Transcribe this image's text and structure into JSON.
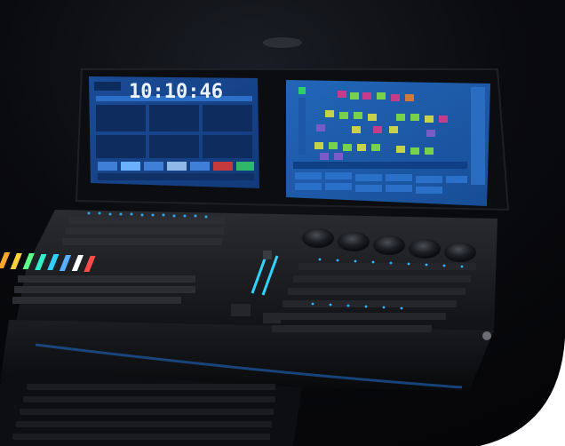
{
  "photo": {
    "subject": "lighting-control-console",
    "left_screen": {
      "clock": "10:10:46"
    },
    "colors": {
      "background": "#07080b",
      "screen_blue": "#1f4f9c",
      "accent_cyan": "#2fd3ff",
      "fader_palette": [
        "#2fc8ff",
        "#24b7ff",
        "#3a8cff",
        "#7a6cff",
        "#b85cff",
        "#ffa52a",
        "#ffd23a",
        "#5cff8a",
        "#2ff0c8",
        "#2fd0ff",
        "#5ab0ff",
        "#ff4a4a"
      ]
    }
  }
}
